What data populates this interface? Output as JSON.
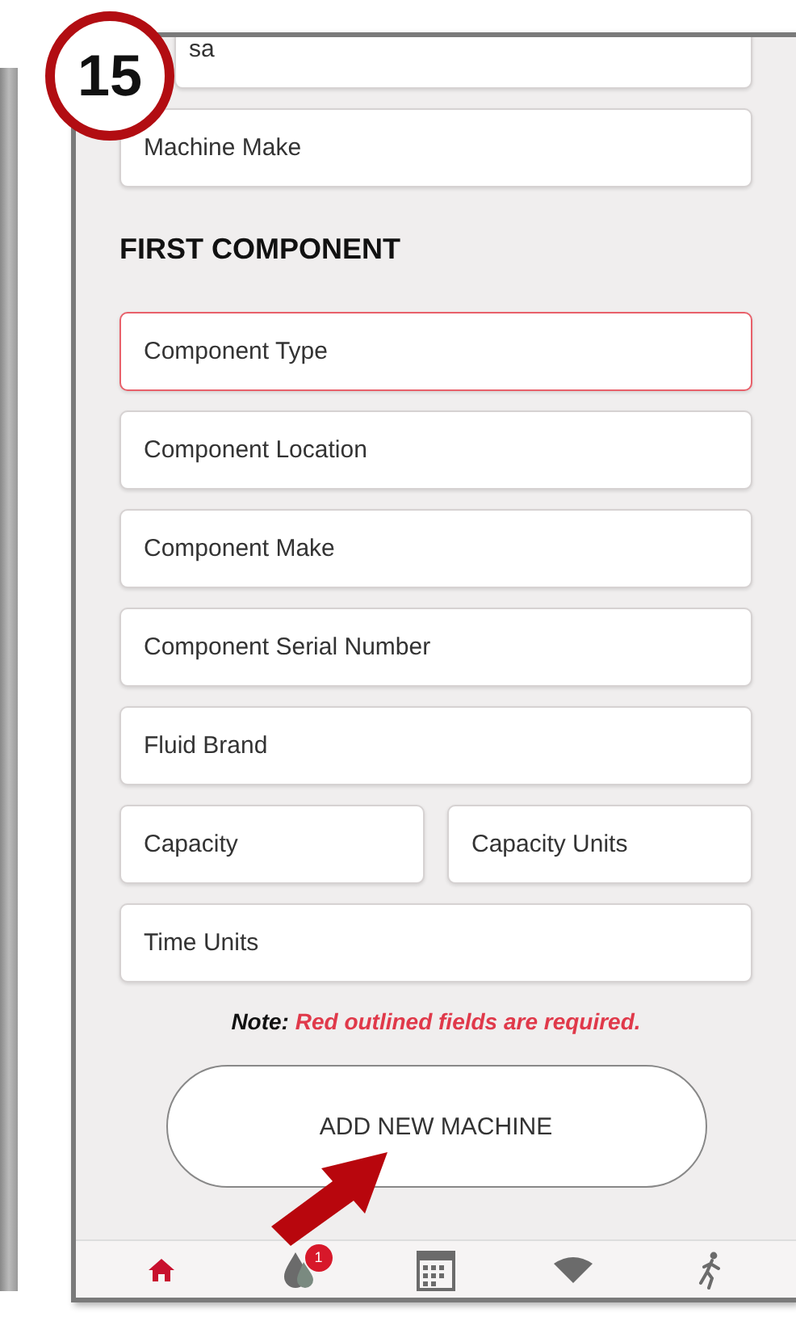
{
  "step_badge": "15",
  "top_fields": [
    {
      "placeholder": "sa",
      "required": false
    },
    {
      "placeholder": "Machine Make",
      "required": false
    }
  ],
  "section_title": "FIRST COMPONENT",
  "component_rows": [
    [
      {
        "placeholder": "Component Type",
        "required": true
      }
    ],
    [
      {
        "placeholder": "Component Location",
        "required": false
      }
    ],
    [
      {
        "placeholder": "Component Make",
        "required": false
      }
    ],
    [
      {
        "placeholder": "Component Serial Number",
        "required": false
      }
    ],
    [
      {
        "placeholder": "Fluid Brand",
        "required": false
      }
    ],
    [
      {
        "placeholder": "Capacity",
        "required": false
      },
      {
        "placeholder": "Capacity Units",
        "required": false
      }
    ],
    [
      {
        "placeholder": "Time Units",
        "required": false
      }
    ]
  ],
  "note": {
    "label": "Note:",
    "text": "Red outlined fields are required."
  },
  "button": "ADD NEW MACHINE",
  "nav": [
    {
      "kind": "home",
      "selected": true
    },
    {
      "kind": "drop",
      "badge": "1",
      "selected": false
    },
    {
      "kind": "calendar",
      "selected": false
    },
    {
      "kind": "wifi",
      "selected": false
    },
    {
      "kind": "runner",
      "selected": false
    }
  ]
}
